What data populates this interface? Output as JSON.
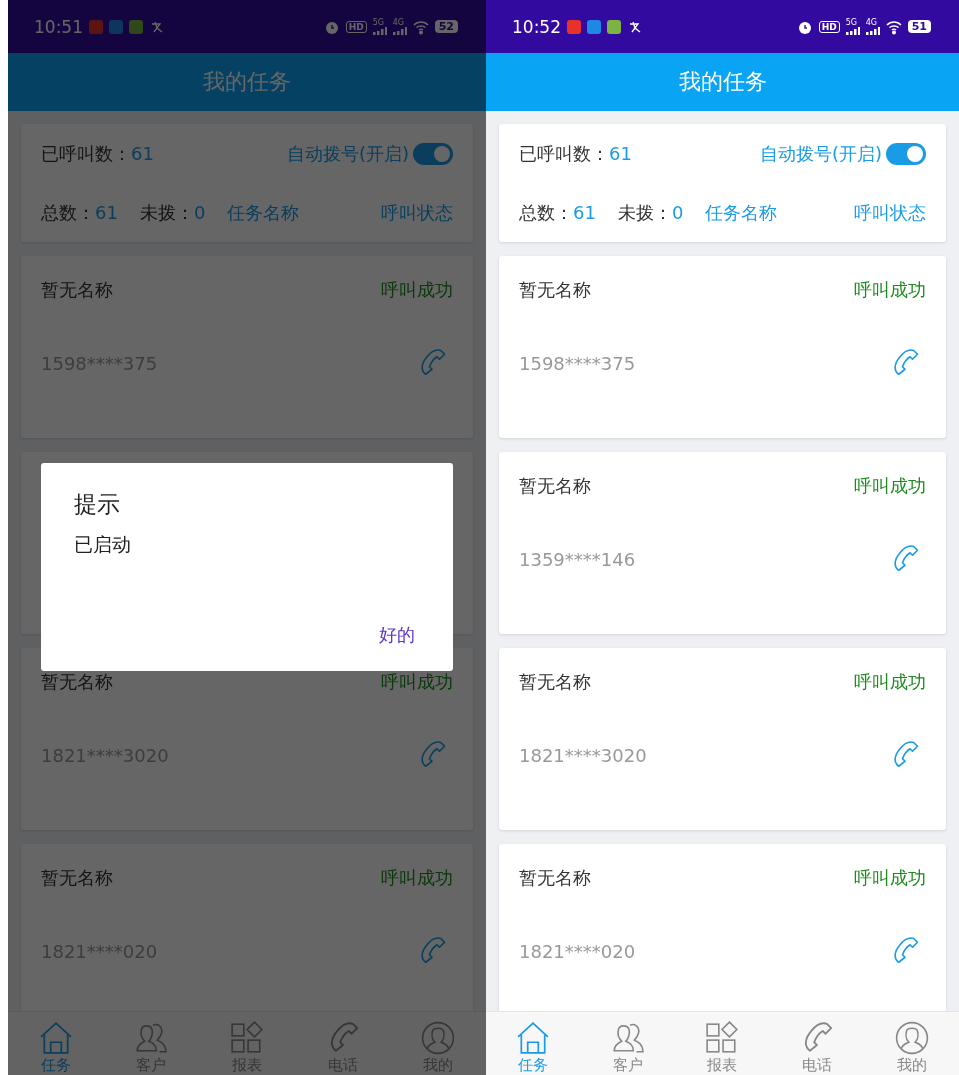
{
  "screens": [
    {
      "status_bar": {
        "time": "10:51",
        "hd": "HD",
        "net_1": "5G",
        "net_2": "4G",
        "battery": "52"
      },
      "header": {
        "title": "我的任务"
      },
      "summary": {
        "called_label": "已呼叫数：",
        "called_value": "61",
        "auto_dial_label": "自动拨号(开启)",
        "auto_dial_on": true,
        "total_label": "总数：",
        "total_value": "61",
        "undialed_label": "未拨：",
        "undialed_value": "0",
        "task_name_link": "任务名称",
        "call_status_link": "呼叫状态"
      },
      "tasks": [
        {
          "name": "暂无名称",
          "status": "呼叫成功",
          "phone": "1598****375"
        },
        {
          "name": "暂无名称",
          "status": "呼叫成功",
          "phone": "1821****3020"
        },
        {
          "name": "暂无名称",
          "status": "呼叫成功",
          "phone": "1821****020"
        }
      ],
      "nav": [
        {
          "kind": "home",
          "label": "任务",
          "selected": true
        },
        {
          "kind": "people",
          "label": "客户",
          "selected": false
        },
        {
          "kind": "grid",
          "label": "报表",
          "selected": false
        },
        {
          "kind": "phone",
          "label": "电话",
          "selected": false
        },
        {
          "kind": "person",
          "label": "我的",
          "selected": false
        }
      ],
      "dialog": {
        "title": "提示",
        "message": "已启动",
        "ok_button": "好的"
      }
    },
    {
      "status_bar": {
        "time": "10:52",
        "hd": "HD",
        "net_1": "5G",
        "net_2": "4G",
        "battery": "51"
      },
      "header": {
        "title": "我的任务"
      },
      "summary": {
        "called_label": "已呼叫数：",
        "called_value": "61",
        "auto_dial_label": "自动拨号(开启)",
        "auto_dial_on": true,
        "total_label": "总数：",
        "total_value": "61",
        "undialed_label": "未拨：",
        "undialed_value": "0",
        "task_name_link": "任务名称",
        "call_status_link": "呼叫状态"
      },
      "tasks": [
        {
          "name": "暂无名称",
          "status": "呼叫成功",
          "phone": "1598****375"
        },
        {
          "name": "暂无名称",
          "status": "呼叫成功",
          "phone": "1359****146"
        },
        {
          "name": "暂无名称",
          "status": "呼叫成功",
          "phone": "1821****3020"
        },
        {
          "name": "暂无名称",
          "status": "呼叫成功",
          "phone": "1821****020"
        }
      ],
      "nav": [
        {
          "kind": "home",
          "label": "任务",
          "selected": true
        },
        {
          "kind": "people",
          "label": "客户",
          "selected": false
        },
        {
          "kind": "grid",
          "label": "报表",
          "selected": false
        },
        {
          "kind": "phone",
          "label": "电话",
          "selected": false
        },
        {
          "kind": "person",
          "label": "我的",
          "selected": false
        }
      ]
    }
  ]
}
